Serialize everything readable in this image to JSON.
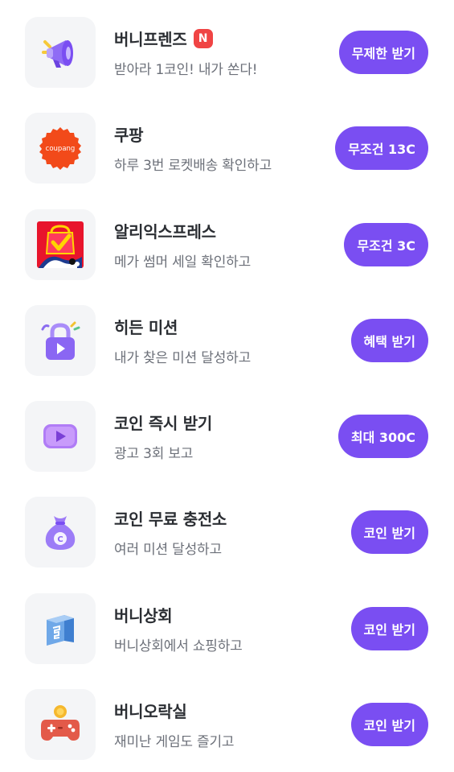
{
  "items": [
    {
      "title": "버니프렌즈",
      "badge": "N",
      "subtitle": "받아라 1코인! 내가 쏜다!",
      "button": "무제한 받기",
      "icon": "megaphone-icon"
    },
    {
      "title": "쿠팡",
      "logo_text": "coupang",
      "subtitle": "하루 3번 로켓배송 확인하고",
      "button": "무조건 13C",
      "icon": "coupang-logo-icon"
    },
    {
      "title": "알리익스프레스",
      "subtitle": "메가 썸머 세일 확인하고",
      "button": "무조건 3C",
      "icon": "aliexpress-logo-icon"
    },
    {
      "title": "히든 미션",
      "subtitle": "내가 찾은 미션 달성하고",
      "button": "혜택 받기",
      "icon": "lock-icon"
    },
    {
      "title": "코인 즉시 받기",
      "subtitle": "광고 3회 보고",
      "button": "최대 300C",
      "icon": "play-video-icon"
    },
    {
      "title": "코인 무료 충전소",
      "subtitle": "여러 미션 달성하고",
      "button": "코인 받기",
      "icon": "money-bag-icon"
    },
    {
      "title": "버니상회",
      "subtitle": "버니상회에서 쇼핑하고",
      "button": "코인 받기",
      "icon": "shopping-box-icon"
    },
    {
      "title": "버니오락실",
      "subtitle": "재미난 게임도 즐기고",
      "button": "코인 받기",
      "icon": "game-controller-icon"
    }
  ],
  "colors": {
    "accent": "#7a4ef2",
    "badge": "#f04444",
    "tile_bg": "#f4f5f7",
    "title": "#2b2e33",
    "subtitle": "#6c7079"
  }
}
